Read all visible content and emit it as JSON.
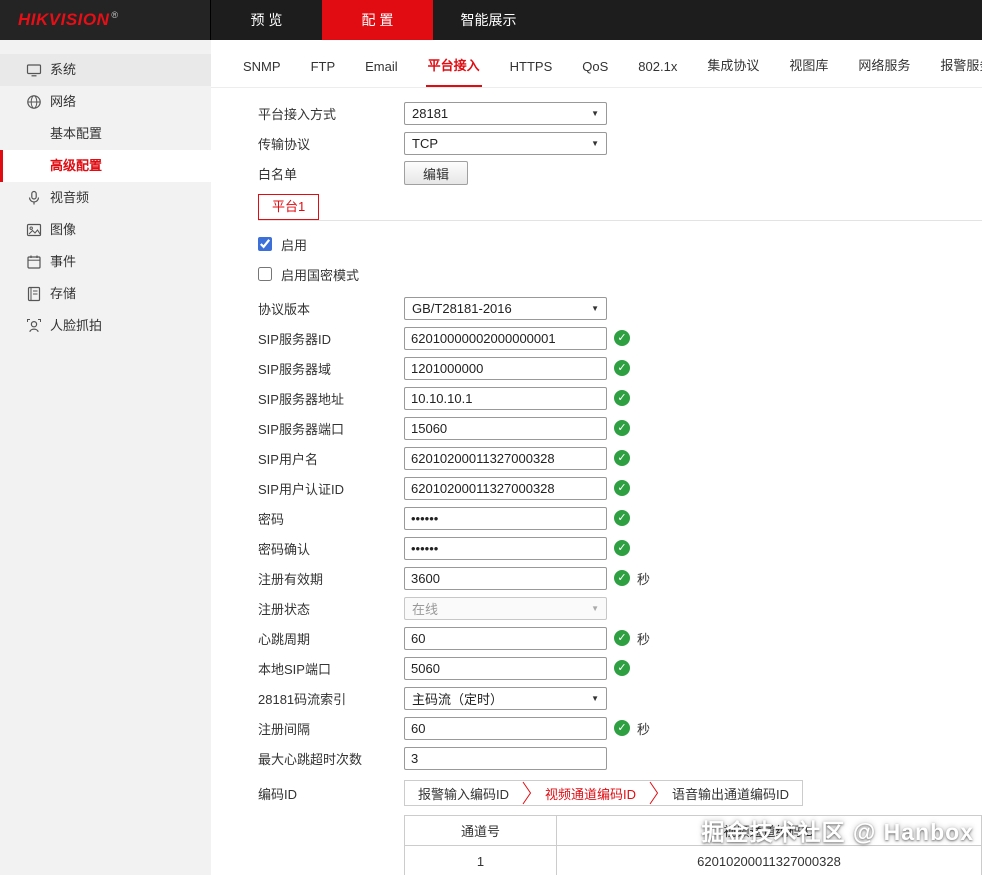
{
  "colors": {
    "accent": "#e00c12",
    "valid_green": "#2fa042",
    "topbar_bg": "#1d1d1d"
  },
  "topbar": {
    "logo": "HIKVISION",
    "reg_mark": "®",
    "menu": [
      {
        "label": "预 览"
      },
      {
        "label": "配 置"
      },
      {
        "label": "智能展示"
      }
    ]
  },
  "sidebar": {
    "items": [
      {
        "label": "系统"
      },
      {
        "label": "网络"
      },
      {
        "label": "基本配置"
      },
      {
        "label": "高级配置"
      },
      {
        "label": "视音频"
      },
      {
        "label": "图像"
      },
      {
        "label": "事件"
      },
      {
        "label": "存储"
      },
      {
        "label": "人脸抓拍"
      }
    ]
  },
  "subtabs": {
    "items": [
      "SNMP",
      "FTP",
      "Email",
      "平台接入",
      "HTTPS",
      "QoS",
      "802.1x",
      "集成协议",
      "视图库",
      "网络服务",
      "报警服务器"
    ],
    "active": "平台接入"
  },
  "top_form": {
    "access_mode_label": "平台接入方式",
    "access_mode_value": "28181",
    "protocol_label": "传输协议",
    "protocol_value": "TCP",
    "whitelist_label": "白名单",
    "whitelist_button": "编辑"
  },
  "platform": {
    "tab_label": "平台1",
    "enable_label": "启用",
    "enable_checked": true,
    "enable_sm_label": "启用国密模式",
    "enable_sm_checked": false
  },
  "fields": [
    {
      "label": "协议版本",
      "value": "GB/T28181-2016"
    },
    {
      "label": "SIP服务器ID",
      "value": "62010000002000000001"
    },
    {
      "label": "SIP服务器域",
      "value": "1201000000"
    },
    {
      "label": "SIP服务器地址",
      "value": "10.10.10.1"
    },
    {
      "label": "SIP服务器端口",
      "value": "15060"
    },
    {
      "label": "SIP用户名",
      "value": "62010200011327000328"
    },
    {
      "label": "SIP用户认证ID",
      "value": "62010200011327000328"
    },
    {
      "label": "密码",
      "value": "••••••"
    },
    {
      "label": "密码确认",
      "value": "••••••"
    },
    {
      "label": "注册有效期",
      "value": "3600",
      "suffix": "秒"
    },
    {
      "label": "注册状态",
      "value": "在线"
    },
    {
      "label": "心跳周期",
      "value": "60",
      "suffix": "秒"
    },
    {
      "label": "本地SIP端口",
      "value": "5060"
    },
    {
      "label": "28181码流索引",
      "value": "主码流（定时）"
    },
    {
      "label": "注册间隔",
      "value": "60",
      "suffix": "秒"
    },
    {
      "label": "最大心跳超时次数",
      "value": "3"
    }
  ],
  "encode_id": {
    "label": "编码ID",
    "tabs": [
      "报警输入编码ID",
      "视频通道编码ID",
      "语音输出通道编码ID"
    ],
    "active": "视频通道编码ID"
  },
  "table": {
    "headers": [
      "通道号",
      "视频通道编码ID"
    ],
    "rows": [
      [
        "1",
        "62010200011327000328"
      ]
    ]
  },
  "watermark": "掘金技术社区 @ Hanbox"
}
